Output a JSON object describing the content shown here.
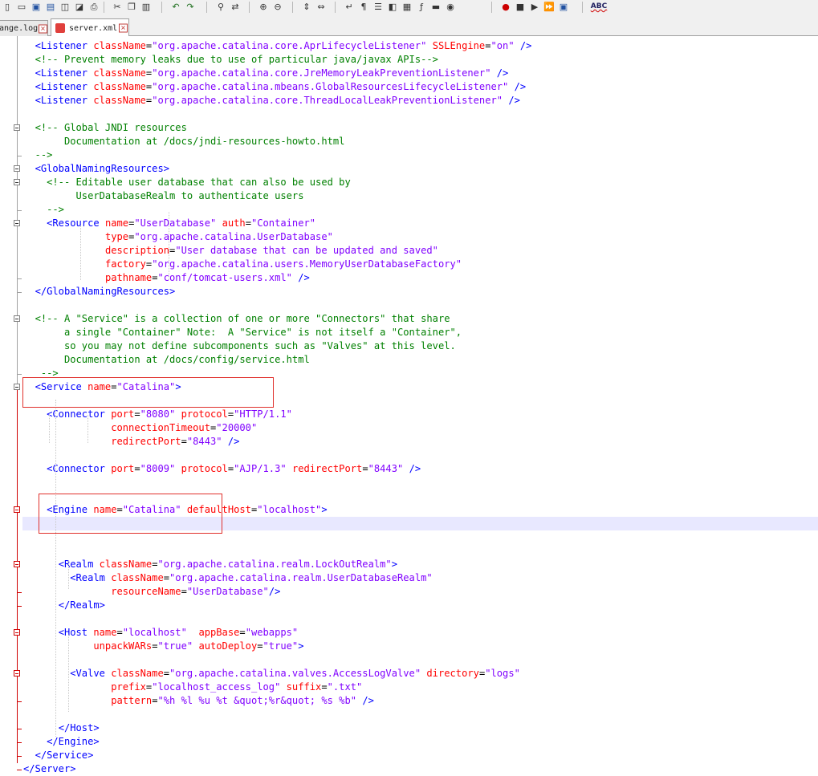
{
  "toolbar": {
    "icons": [
      "new-file-icon",
      "open-file-icon",
      "save-icon",
      "save-all-icon",
      "close-file-icon",
      "close-all-icon",
      "print-icon",
      "cut-icon",
      "copy-icon",
      "paste-icon",
      "undo-icon",
      "redo-icon",
      "find-icon",
      "replace-icon",
      "zoom-in-icon",
      "zoom-out-icon",
      "sync-vertical-icon",
      "sync-horizontal-icon",
      "word-wrap-icon",
      "show-all-chars-icon",
      "indent-guide-icon",
      "user-defined-lang-icon",
      "doc-map-icon",
      "function-list-icon",
      "folder-workspace-icon",
      "monitoring-icon",
      "record-macro-icon",
      "stop-macro-icon",
      "play-macro-icon",
      "run-macro-multiple-icon",
      "save-macro-icon",
      "spell-check-icon"
    ],
    "spell_check_label": "ABC"
  },
  "tabs": [
    {
      "label": "ange.log",
      "active": false
    },
    {
      "label": "server.xml",
      "active": true
    }
  ],
  "code_lines": [
    "  <Listener className=\"org.apache.catalina.core.AprLifecycleListener\" SSLEngine=\"on\" />",
    "  <!-- Prevent memory leaks due to use of particular java/javax APIs-->",
    "  <Listener className=\"org.apache.catalina.core.JreMemoryLeakPreventionListener\" />",
    "  <Listener className=\"org.apache.catalina.mbeans.GlobalResourcesLifecycleListener\" />",
    "  <Listener className=\"org.apache.catalina.core.ThreadLocalLeakPreventionListener\" />",
    "",
    "  <!-- Global JNDI resources",
    "       Documentation at /docs/jndi-resources-howto.html",
    "  -->",
    "  <GlobalNamingResources>",
    "    <!-- Editable user database that can also be used by",
    "         UserDatabaseRealm to authenticate users",
    "    -->",
    "    <Resource name=\"UserDatabase\" auth=\"Container\"",
    "              type=\"org.apache.catalina.UserDatabase\"",
    "              description=\"User database that can be updated and saved\"",
    "              factory=\"org.apache.catalina.users.MemoryUserDatabaseFactory\"",
    "              pathname=\"conf/tomcat-users.xml\" />",
    "  </GlobalNamingResources>",
    "",
    "  <!-- A \"Service\" is a collection of one or more \"Connectors\" that share",
    "       a single \"Container\" Note:  A \"Service\" is not itself a \"Container\",",
    "       so you may not define subcomponents such as \"Valves\" at this level.",
    "       Documentation at /docs/config/service.html",
    "   -->",
    "  <Service name=\"Catalina\">",
    "",
    "    <Connector port=\"8080\" protocol=\"HTTP/1.1\"",
    "               connectionTimeout=\"20000\"",
    "               redirectPort=\"8443\" />",
    "",
    "    <Connector port=\"8009\" protocol=\"AJP/1.3\" redirectPort=\"8443\" />",
    "",
    "",
    "    <Engine name=\"Catalina\" defaultHost=\"localhost\">",
    "",
    "",
    "",
    "      <Realm className=\"org.apache.catalina.realm.LockOutRealm\">",
    "        <Realm className=\"org.apache.catalina.realm.UserDatabaseRealm\"",
    "               resourceName=\"UserDatabase\"/>",
    "      </Realm>",
    "",
    "      <Host name=\"localhost\"  appBase=\"webapps\"",
    "            unpackWARs=\"true\" autoDeploy=\"true\">",
    "",
    "        <Valve className=\"org.apache.catalina.valves.AccessLogValve\" directory=\"logs\"",
    "               prefix=\"localhost_access_log\" suffix=\".txt\"",
    "               pattern=\"%h %l %u %t &quot;%r&quot; %s %b\" />",
    "",
    "      </Host>",
    "    </Engine>",
    "  </Service>",
    "</Server>"
  ],
  "highlights": {
    "service_box_color": "#e0302c",
    "engine_box_color": "#e0302c",
    "current_line_color": "#e8e8ff"
  },
  "syntax_colors": {
    "tag": "#0000ff",
    "attribute": "#ff0000",
    "value": "#8000ff",
    "comment": "#008000"
  }
}
